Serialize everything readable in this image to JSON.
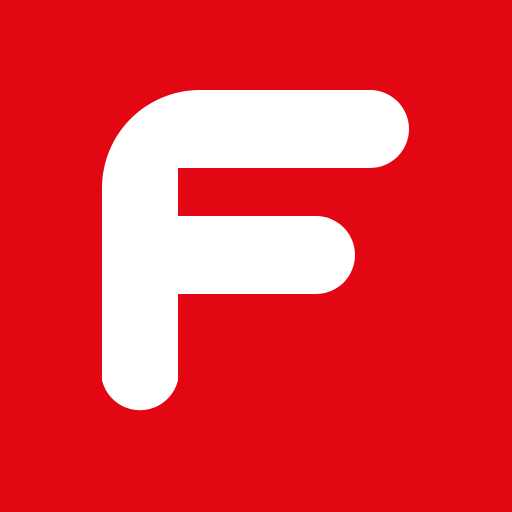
{
  "icon": {
    "name": "f-logo-icon",
    "background_color": "#e30613",
    "glyph_color": "#ffffff"
  }
}
